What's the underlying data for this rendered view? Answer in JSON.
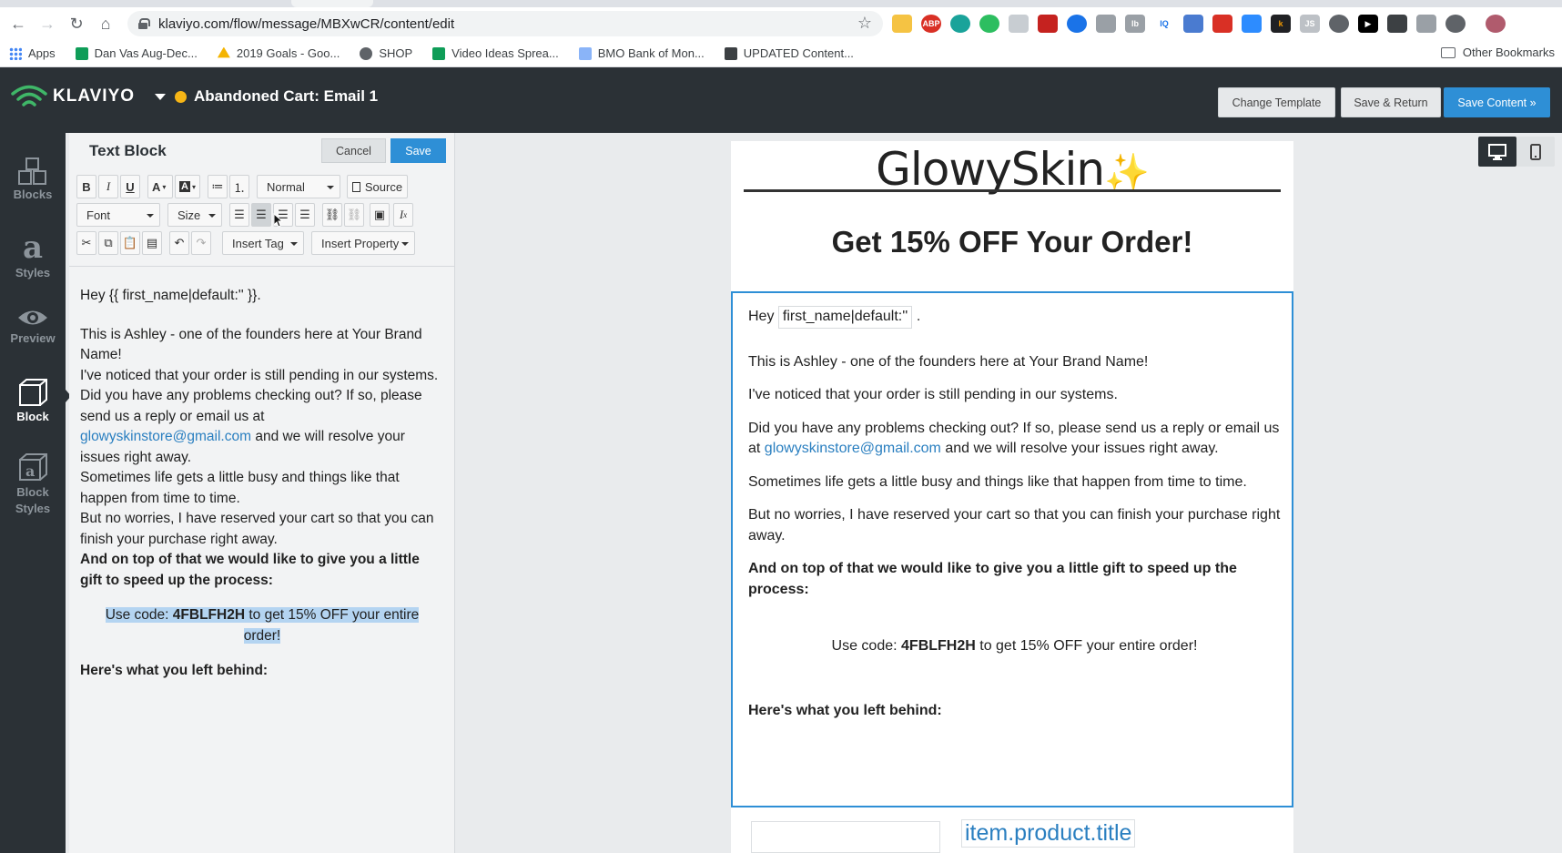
{
  "browser": {
    "url": "klaviyo.com/flow/message/MBXwCR/content/edit",
    "bookmarks": [
      {
        "label": "Apps",
        "color": "#4285f4"
      },
      {
        "label": "Dan Vas Aug-Dec...",
        "color": "#0f9d58"
      },
      {
        "label": "2019 Goals - Goo...",
        "color": "#f4b400"
      },
      {
        "label": "SHOP",
        "color": "#5f6368"
      },
      {
        "label": "Video Ideas Sprea...",
        "color": "#0f9d58"
      },
      {
        "label": "BMO Bank of Mon...",
        "color": "#8ab4f8"
      },
      {
        "label": "UPDATED Content...",
        "color": "#3c4043"
      }
    ],
    "other_bookmarks": "Other Bookmarks"
  },
  "header": {
    "logo": "KLAVIYO",
    "flow_title": "Abandoned Cart: Email 1",
    "status_color": "#f6b516",
    "buttons": {
      "change_template": "Change Template",
      "save_return": "Save & Return",
      "save_content": "Save Content »"
    }
  },
  "sidebar": {
    "items": [
      {
        "label": "Blocks"
      },
      {
        "label": "Styles"
      },
      {
        "label": "Preview"
      },
      {
        "label": "Block"
      },
      {
        "label": "Block Styles"
      }
    ]
  },
  "editor": {
    "title": "Text Block",
    "help": "?",
    "cancel": "Cancel",
    "save": "Save",
    "toolbar": {
      "format": "Normal",
      "source": "Source",
      "font": "Font",
      "size": "Size",
      "insert_tag": "Insert Tag",
      "insert_property": "Insert Property"
    },
    "body": {
      "greeting": "Hey {{ first_name|default:'' }}.",
      "l1": "This is Ashley - one of the founders here at Your Brand Name!",
      "l2": "I've noticed that your order is still pending in our systems.",
      "l3a": "Did you have any problems checking out?",
      "l3b": " If so, please send us a reply or email us at",
      "email": "glowyskinstore@gmail.com",
      "l3c": " and we will resolve your issues right away.",
      "l4": "Sometimes life gets a little busy and things like that happen from time to time.",
      "l5": "But no worries, I have reserved your cart so that you can finish your purchase right away.",
      "l6": "And on top of that we would like to give you a little gift to speed up the process:",
      "code_pre": "Use code: ",
      "code": "4FBLFH2H",
      "code_post": " to get 15% OFF your entire order!",
      "left_behind": "Here's what you left behind:"
    }
  },
  "email": {
    "brand": "GlowySkin",
    "brand_spark": "✨",
    "headline": "Get 15% OFF Your Order!",
    "hey": "Hey",
    "merge_tag": "first_name|default:''",
    "period": ".",
    "p1": "This is Ashley - one of the founders here at Your Brand Name!",
    "p2": "I've noticed that your order is still pending in our systems.",
    "p3a": "Did you have any problems checking out? If so, please send us a reply or email us at",
    "email": "glowyskinstore@gmail.com",
    "p3b": "and we will resolve your issues right away.",
    "p4": "Sometimes life gets a little busy and things like that happen from time to time.",
    "p5": "But no worries, I have reserved your cart so that you can finish your purchase right away.",
    "p6": "And on top of that we would like to give you a little gift to speed up the process:",
    "code_pre": "Use code: ",
    "code": "4FBLFH2H",
    "code_post": " to get 15% OFF your entire order!",
    "left_behind": "Here's what you left behind:",
    "product_title": "item.product.title"
  }
}
